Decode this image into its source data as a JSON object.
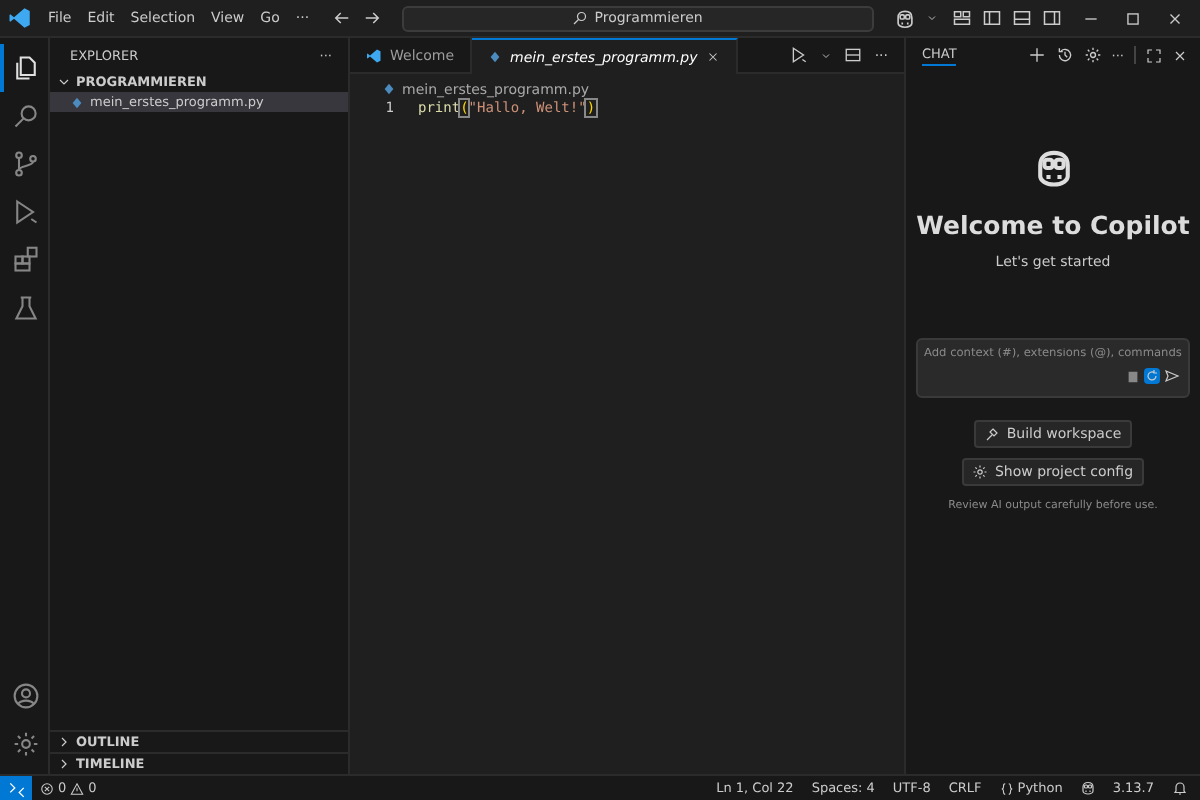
{
  "menu": [
    "File",
    "Edit",
    "Selection",
    "View",
    "Go",
    "···"
  ],
  "command_center": "Programmieren",
  "activity_bar": [
    {
      "kind": "files",
      "selected": true
    },
    {
      "kind": "search",
      "selected": false
    },
    {
      "kind": "branch",
      "selected": false
    },
    {
      "kind": "run",
      "selected": false
    },
    {
      "kind": "extensions",
      "selected": false
    },
    {
      "kind": "flask",
      "selected": false
    }
  ],
  "sidebar": {
    "title": "EXPLORER",
    "more": "···",
    "folder": {
      "label": "PROGRAMMIEREN",
      "expanded": true,
      "children": [
        {
          "label": "mein_erstes_programm.py",
          "selected": true
        }
      ]
    },
    "sections": [
      {
        "label": "OUTLINE",
        "expanded": false
      },
      {
        "label": "TIMELINE",
        "expanded": false
      }
    ]
  },
  "editor": {
    "tabs": [
      {
        "label": "Welcome",
        "kind": "welcome",
        "selected": false
      },
      {
        "label": "mein_erstes_programm.py",
        "kind": "python",
        "selected": true
      }
    ],
    "more": "···",
    "breadcrumb": "mein_erstes_programm.py",
    "lines": [
      {
        "number": "1",
        "tokens": [
          {
            "text": "print",
            "kind": "function"
          },
          {
            "text": "(",
            "kind": "bracket"
          },
          {
            "text": "\"Hallo, Welt!\"",
            "kind": "string"
          },
          {
            "text": ")",
            "kind": "bracket"
          }
        ]
      }
    ]
  },
  "chat": {
    "title": "CHAT",
    "more": "···",
    "heading": "Welcome to Copilot",
    "subheading": "Let's get started",
    "input": {
      "placeholder": "Add context (#), extensions (@), commands"
    },
    "buttons": [
      {
        "label": "Build workspace",
        "kind": "build"
      },
      {
        "label": "Show project config",
        "kind": "config"
      }
    ],
    "note": "Review AI output carefully before use."
  },
  "status_bar": {
    "errors": "0",
    "warnings": "0",
    "items": [
      {
        "label": "Ln 1, Col 22",
        "kind": "text"
      },
      {
        "label": "Spaces: 4",
        "kind": "text"
      },
      {
        "label": "UTF-8",
        "kind": "text"
      },
      {
        "label": "CRLF",
        "kind": "text"
      },
      {
        "label": "Python",
        "kind": "language"
      },
      {
        "label": "3.13.7",
        "kind": "version"
      }
    ]
  }
}
